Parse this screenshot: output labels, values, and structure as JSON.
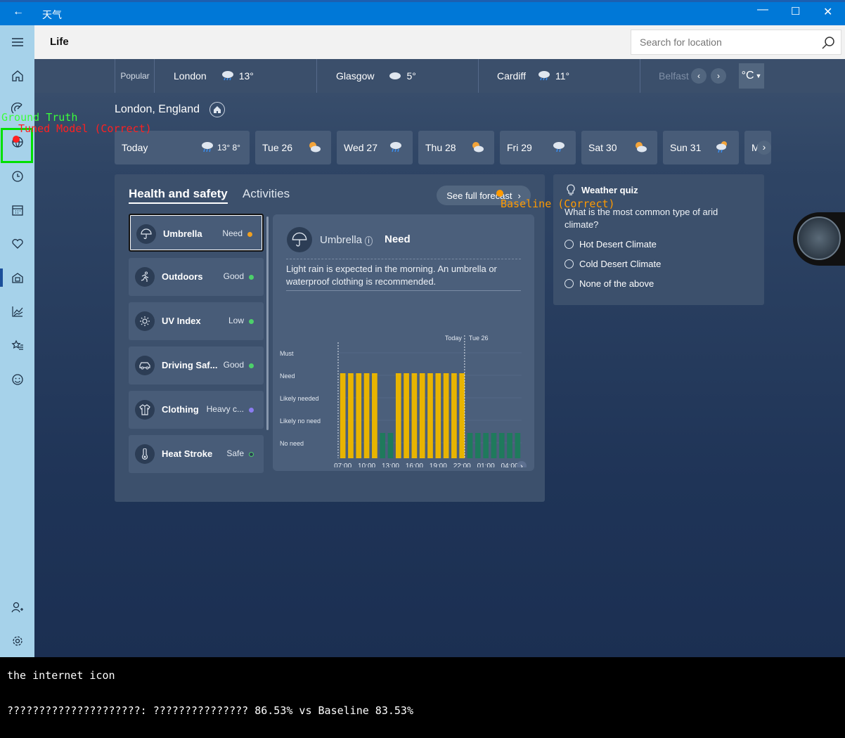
{
  "window": {
    "title": "天气"
  },
  "header": {
    "page_title": "Life",
    "search_placeholder": "Search for location"
  },
  "rail": {
    "icons": [
      "hamburger-icon",
      "home-icon",
      "radar-icon",
      "internet-icon",
      "history-icon",
      "calendar-icon",
      "heart-icon",
      "life-icon",
      "chart-icon",
      "favorites-icon",
      "smiley-icon",
      "add-user-icon",
      "settings-icon"
    ]
  },
  "popular": {
    "label": "Popular",
    "cities": [
      {
        "name": "London",
        "temp": "13°"
      },
      {
        "name": "Glasgow",
        "temp": "5°"
      },
      {
        "name": "Cardiff",
        "temp": "11°"
      },
      {
        "name": "Belfast",
        "temp": ""
      }
    ],
    "unit": "°C"
  },
  "location": "London, England",
  "days": [
    {
      "label": "Today",
      "temps": "13° 8°"
    },
    {
      "label": "Tue 26"
    },
    {
      "label": "Wed 27"
    },
    {
      "label": "Thu 28"
    },
    {
      "label": "Fri 29"
    },
    {
      "label": "Sat 30"
    },
    {
      "label": "Sun 31"
    },
    {
      "label": "M"
    }
  ],
  "panel": {
    "tab_health": "Health and safety",
    "tab_activities": "Activities",
    "forecast_btn": "See full forecast",
    "items": [
      {
        "name": "Umbrella",
        "status": "Need",
        "dot": "#f0a020"
      },
      {
        "name": "Outdoors",
        "status": "Good",
        "dot": "#4cd06a"
      },
      {
        "name": "UV Index",
        "status": "Low",
        "dot": "#4cd06a"
      },
      {
        "name": "Driving Saf...",
        "status": "Good",
        "dot": "#4cd06a"
      },
      {
        "name": "Clothing",
        "status": "Heavy c...",
        "dot": "#8a7cf0"
      },
      {
        "name": "Heat Stroke",
        "status": "Safe",
        "dot": "#4cd06a"
      }
    ],
    "detail": {
      "name": "Umbrella",
      "status": "Need",
      "desc": "Light rain is expected in the morning. An umbrella or waterproof clothing is recommended."
    }
  },
  "chart_data": {
    "type": "bar",
    "y_levels": [
      "Must",
      "Need",
      "Likely needed",
      "Likely no need",
      "No need"
    ],
    "x_tick_labels": [
      "07:00",
      "10:00",
      "13:00",
      "16:00",
      "19:00",
      "22:00",
      "01:00",
      "04:00"
    ],
    "markers": [
      "Today",
      "Tue 26"
    ],
    "values": [
      2,
      2,
      2,
      2,
      2,
      1,
      1,
      2,
      2,
      2,
      2,
      2,
      2,
      2,
      2,
      2,
      1,
      1,
      1,
      1,
      1,
      1,
      1
    ],
    "colors": {
      "need": "#e8b400",
      "no_need": "#1f7a5c"
    }
  },
  "quiz": {
    "title": "Weather quiz",
    "question": "What is the most common type of arid climate?",
    "options": [
      "Hot Desert Climate",
      "Cold Desert Climate",
      "None of the above"
    ]
  },
  "annotations": {
    "ground_truth": "Ground Truth",
    "tuned": "Tuned Model (Correct)",
    "baseline": "Baseline (Correct)"
  },
  "caption": {
    "line1": "the internet icon",
    "line2": "?????????????????????: ??????????????? 86.53% vs Baseline 83.53%"
  }
}
